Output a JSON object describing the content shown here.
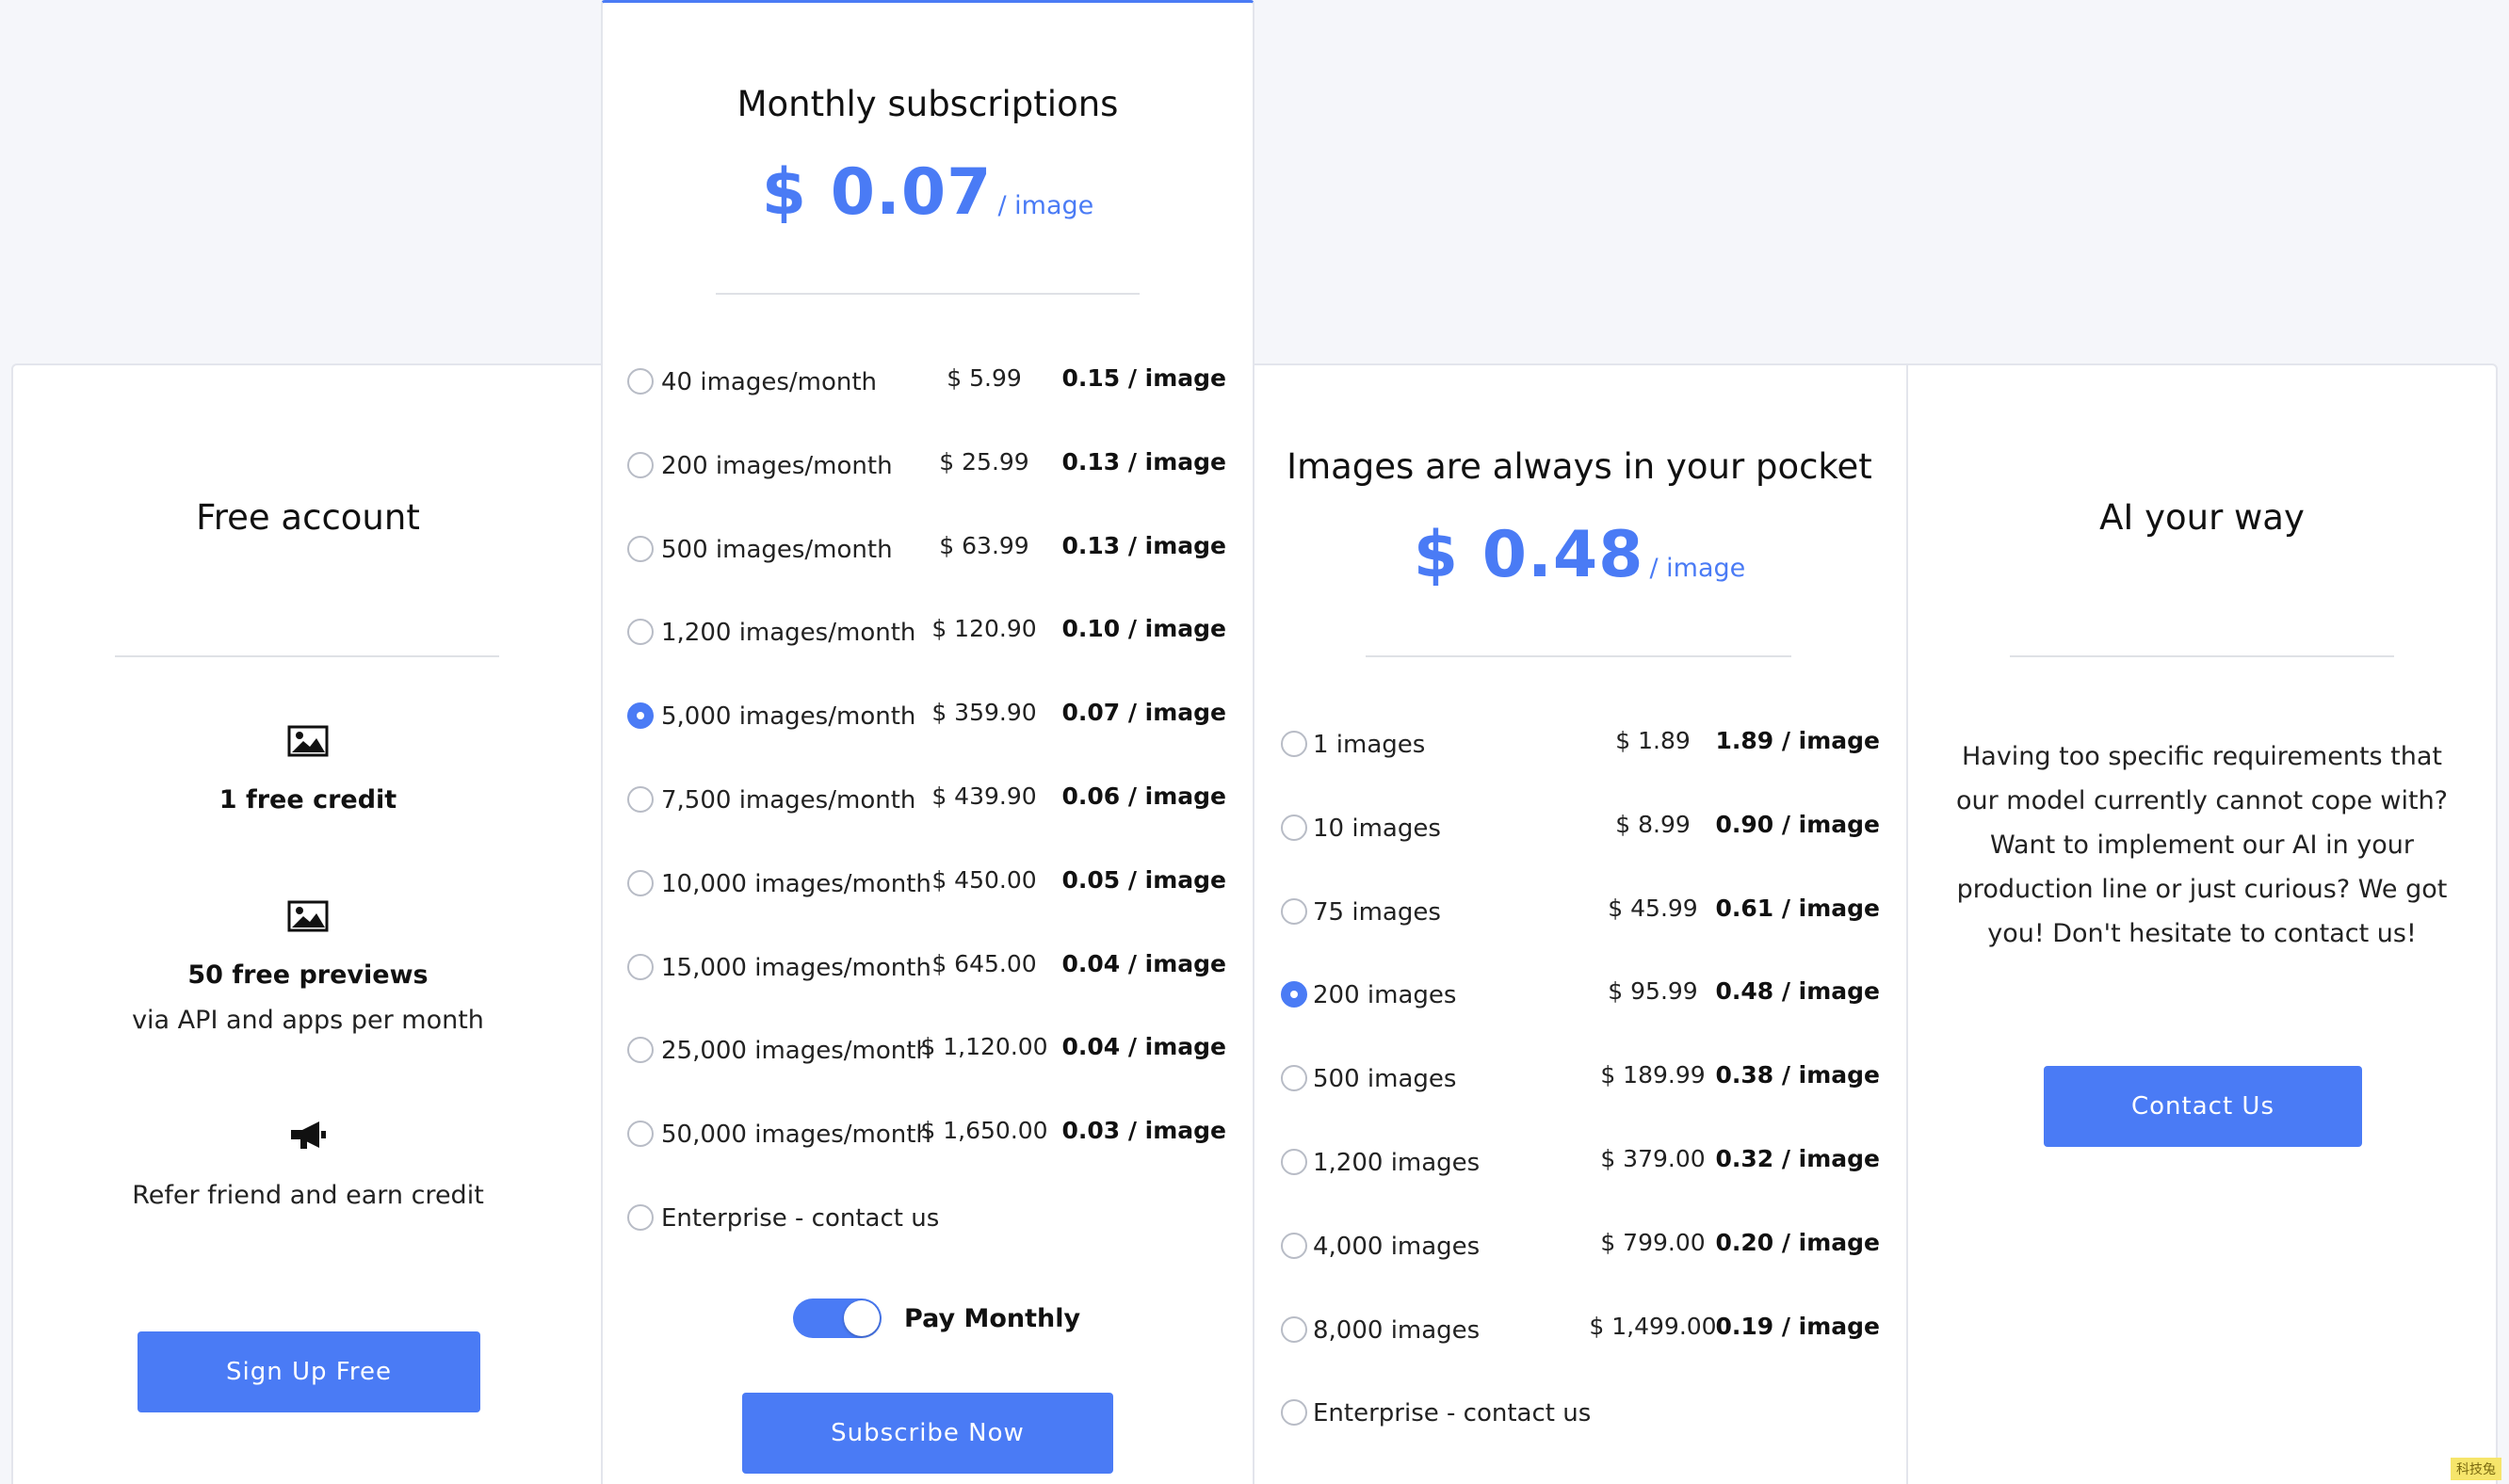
{
  "free": {
    "title": "Free account",
    "features": [
      {
        "icon": "image-icon",
        "bold": "1 free credit",
        "text": ""
      },
      {
        "icon": "image-icon",
        "bold": "50 free previews",
        "text": "via API and apps per month"
      },
      {
        "icon": "megaphone-icon",
        "bold": "",
        "text": "Refer friend and earn credit"
      }
    ],
    "button": "Sign Up Free"
  },
  "monthly": {
    "title": "Monthly subscriptions",
    "price": "$ 0.07",
    "price_unit": "/ image",
    "options": [
      {
        "label": "40 images/month",
        "price": "$ 5.99",
        "per": "0.15 / image",
        "checked": false
      },
      {
        "label": "200 images/month",
        "price": "$ 25.99",
        "per": "0.13 / image",
        "checked": false
      },
      {
        "label": "500 images/month",
        "price": "$ 63.99",
        "per": "0.13 / image",
        "checked": false
      },
      {
        "label": "1,200 images/month",
        "price": "$ 120.90",
        "per": "0.10 / image",
        "checked": false
      },
      {
        "label": "5,000 images/month",
        "price": "$ 359.90",
        "per": "0.07 / image",
        "checked": true
      },
      {
        "label": "7,500 images/month",
        "price": "$ 439.90",
        "per": "0.06 / image",
        "checked": false
      },
      {
        "label": "10,000 images/month",
        "price": "$ 450.00",
        "per": "0.05 / image",
        "checked": false
      },
      {
        "label": "15,000 images/month",
        "price": "$ 645.00",
        "per": "0.04 / image",
        "checked": false
      },
      {
        "label": "25,000 images/month",
        "price": "$ 1,120.00",
        "per": "0.04 / image",
        "checked": false
      },
      {
        "label": "50,000 images/month",
        "price": "$ 1,650.00",
        "per": "0.03 / image",
        "checked": false
      },
      {
        "label": "Enterprise - contact us",
        "price": "",
        "per": "",
        "checked": false
      }
    ],
    "toggle_label": "Pay Monthly",
    "toggle_on": true,
    "button": "Subscribe Now"
  },
  "payg": {
    "title": "Images are always in your pocket",
    "price": "$ 0.48",
    "price_unit": "/ image",
    "options": [
      {
        "label": "1 images",
        "price": "$ 1.89",
        "per": "1.89 / image",
        "checked": false
      },
      {
        "label": "10 images",
        "price": "$ 8.99",
        "per": "0.90 / image",
        "checked": false
      },
      {
        "label": "75 images",
        "price": "$ 45.99",
        "per": "0.61 / image",
        "checked": false
      },
      {
        "label": "200 images",
        "price": "$ 95.99",
        "per": "0.48 / image",
        "checked": true
      },
      {
        "label": "500 images",
        "price": "$ 189.99",
        "per": "0.38 / image",
        "checked": false
      },
      {
        "label": "1,200 images",
        "price": "$ 379.00",
        "per": "0.32 / image",
        "checked": false
      },
      {
        "label": "4,000 images",
        "price": "$ 799.00",
        "per": "0.20 / image",
        "checked": false
      },
      {
        "label": "8,000 images",
        "price": "$ 1,499.00",
        "per": "0.19 / image",
        "checked": false
      },
      {
        "label": "Enterprise - contact us",
        "price": "",
        "per": "",
        "checked": false
      }
    ]
  },
  "ai": {
    "title": "AI your way",
    "description": "Having too specific requirements that our model currently cannot cope with? Want to implement our AI in your production line or just curious? We got you! Don't hesitate to contact us!",
    "button": "Contact Us"
  },
  "watermark": "科技兔",
  "colors": {
    "accent": "#4a7bf5",
    "background": "#f5f6fa"
  }
}
